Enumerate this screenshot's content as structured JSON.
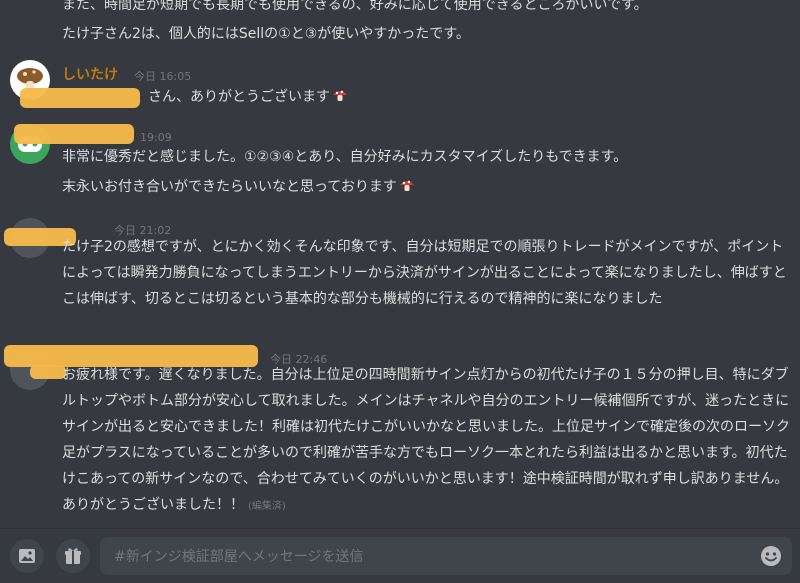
{
  "messages": {
    "top_lines": [
      "また、時間足が短期でも長期でも使用できるの、好みに応じて使用できるところがいいです。",
      "たけ子さん2は、個人的にはSellの①と③が使いやすかったです。"
    ],
    "m1": {
      "username": "しいたけ",
      "timestamp": "今日 16:05",
      "text": "さん、ありがとうございます",
      "emoji": "mushroom-emoji"
    },
    "m2": {
      "timestamp": "19:09",
      "lines": [
        "非常に優秀だと感じました。①②③④とあり、自分好みにカスタマイズしたりもできます。",
        "末永いお付き合いができたらいいなと思っております"
      ],
      "emoji": "mushroom-emoji"
    },
    "m3": {
      "timestamp": "今日 21:02",
      "text": "たけ子2の感想ですが、とにかく効くそんな印象です、自分は短期足での順張りトレードがメインですが、ポイントによっては瞬発力勝負になってしまうエントリーから決済がサインが出ることによって楽になりましたし、伸ばすとこは伸ばす、切るとこは切るという基本的な部分も機械的に行えるので精神的に楽になりました"
    },
    "m4": {
      "timestamp": "今日 22:46",
      "text": "お疲れ様です。遅くなりました。自分は上位足の四時間新サイン点灯からの初代たけ子の１５分の押し目、特にダブルトップやボトム部分が安心して取れました。メインはチャネルや自分のエントリー候補個所ですが、迷ったときにサインが出ると安心できました！利確は初代たけこがいいかなと思いました。上位足サインで確定後の次のローソク足がプラスになっていることが多いので利確が苦手な方でもローソク一本とれたら利益は出るかと思います。初代たけこあっての新サインなので、合わせてみていくのがいいかと思います！途中検証時間が取れず申し訳ありません。ありがとうございました！！",
      "edited": "(編集済)"
    }
  },
  "composer": {
    "placeholder": "#新インジ検証部屋へメッセージを送信",
    "image_icon": "image-icon",
    "gift_icon": "gift-icon",
    "emoji_icon": "smiley-icon"
  },
  "colors": {
    "background": "#36393f",
    "username_shiitake": "#c27c0e",
    "redaction": "#f5b94a"
  }
}
